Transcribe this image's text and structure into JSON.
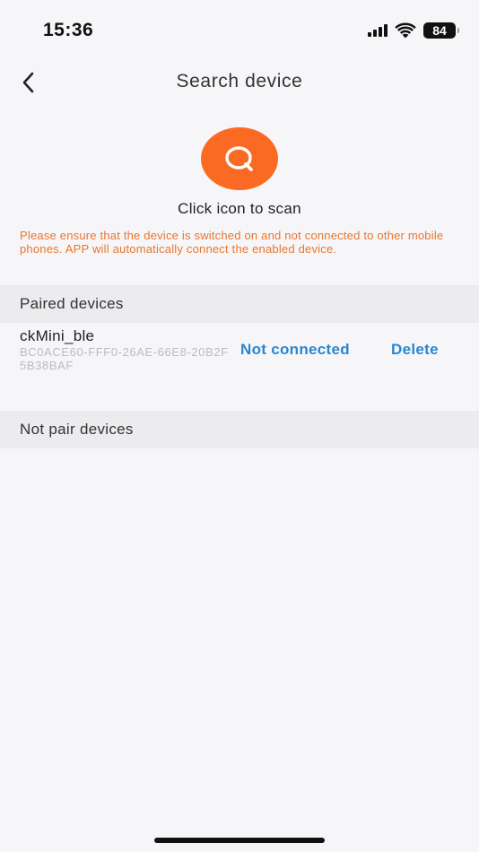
{
  "status_bar": {
    "time": "15:36",
    "battery": "84",
    "icons": [
      "signal-icon",
      "wifi-icon",
      "battery-icon"
    ]
  },
  "nav": {
    "title": "Search device",
    "back_icon": "chevron-left-icon"
  },
  "scan": {
    "icon": "search-icon",
    "label": "Click icon to scan",
    "button_color": "#fb6a22"
  },
  "warning": "Please ensure that the device is switched on and not connected to other mobile phones. APP will automatically connect the enabled device.",
  "paired_section": {
    "title": "Paired devices",
    "devices": [
      {
        "name": "ckMini_ble",
        "id": "BC0ACE60-FFF0-26AE-66E8-20B2F5B38BAF",
        "status": "Not connected",
        "action": "Delete"
      }
    ]
  },
  "unpaired_section": {
    "title": "Not pair devices"
  },
  "colors": {
    "accent": "#2a86d0",
    "warning": "#e8762e",
    "background": "#f6f6f8",
    "section_bg": "#ececee"
  }
}
